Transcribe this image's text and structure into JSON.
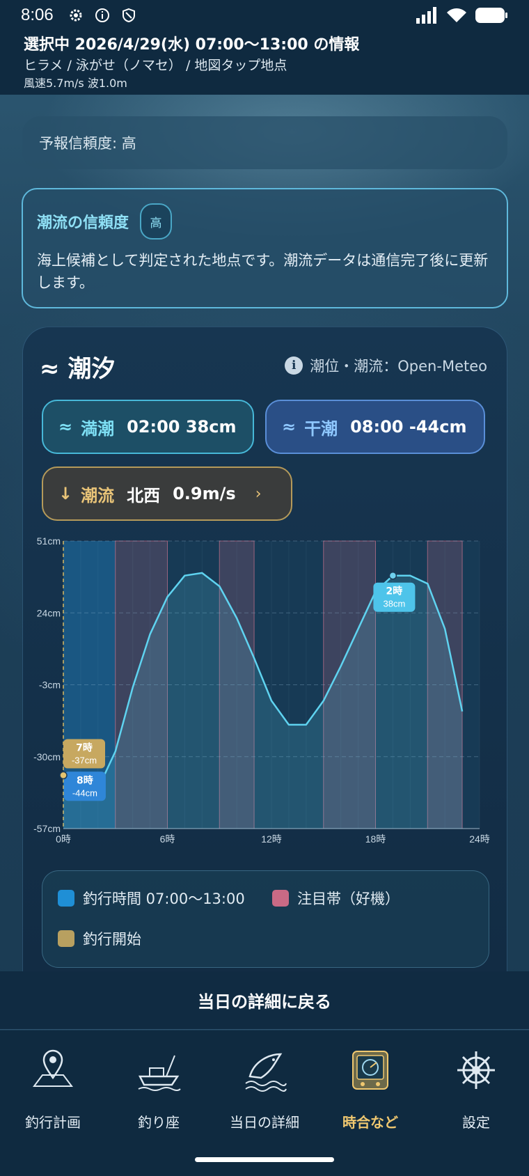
{
  "status": {
    "time": "8:06"
  },
  "header": {
    "line1": "選択中 2026/4/29(水) 07:00〜13:00 の情報",
    "line2": "ヒラメ / 泳がせ（ノマセ） / 地図タップ地点",
    "line3": "風速5.7m/s  波1.0m"
  },
  "forecast": {
    "text": "予報信頼度: 高"
  },
  "current_reliability": {
    "title": "潮流の信頼度",
    "badge": "高",
    "desc": "海上候補として判定された地点です。潮流データは通信完了後に更新します。"
  },
  "tide": {
    "title": "≈ 潮汐",
    "source": "潮位・潮流：Open-Meteo",
    "high": {
      "icon": "≈",
      "label": "満潮",
      "value": "02:00  38cm"
    },
    "low": {
      "icon": "≈",
      "label": "干潮",
      "value": "08:00  -44cm"
    },
    "current": {
      "icon": "↓",
      "label": "潮流",
      "value": "北西",
      "speed": "0.9m/s"
    }
  },
  "colors": {
    "fishing": "#1f8fd6",
    "focus": "#c96a85",
    "start": "#b8a060",
    "line": "#5fd3f0"
  },
  "chart_data": {
    "type": "line",
    "x_unit": "時",
    "x": [
      0,
      1,
      2,
      3,
      4,
      5,
      6,
      7,
      8,
      9,
      10,
      11,
      12,
      13,
      14,
      15,
      16,
      17,
      18,
      19,
      20,
      21,
      22,
      23
    ],
    "values": [
      -37,
      -44,
      -42,
      -28,
      -4,
      16,
      30,
      38,
      39,
      34,
      22,
      7,
      -9,
      -18,
      -18,
      -9,
      4,
      18,
      32,
      38,
      38,
      35,
      18,
      -13
    ],
    "ylim": [
      -57,
      51
    ],
    "yticks": [
      "51cm",
      "24cm",
      "-3cm",
      "-30cm",
      "-57cm"
    ],
    "xticks": [
      "0時",
      "6時",
      "12時",
      "18時",
      "24時"
    ],
    "fishing_window": [
      0,
      3
    ],
    "focus_bands": [
      [
        3,
        6
      ],
      [
        9,
        11
      ],
      [
        15,
        18
      ],
      [
        21,
        23
      ]
    ],
    "labels": [
      {
        "hour": 1,
        "time": "8時",
        "value": "-44cm"
      },
      {
        "hour": 0,
        "time": "7時",
        "value": "-37cm"
      },
      {
        "hour": 19,
        "time": "2時",
        "value": "38cm"
      }
    ]
  },
  "legend": {
    "fishing": "釣行時間 07:00〜13:00",
    "focus": "注目帯（好機）",
    "start": "釣行開始"
  },
  "return_label": "当日の詳細に戻る",
  "nav": {
    "items": [
      {
        "label": "釣行計画"
      },
      {
        "label": "釣り座"
      },
      {
        "label": "当日の詳細"
      },
      {
        "label": "時合など"
      },
      {
        "label": "設定"
      }
    ]
  }
}
